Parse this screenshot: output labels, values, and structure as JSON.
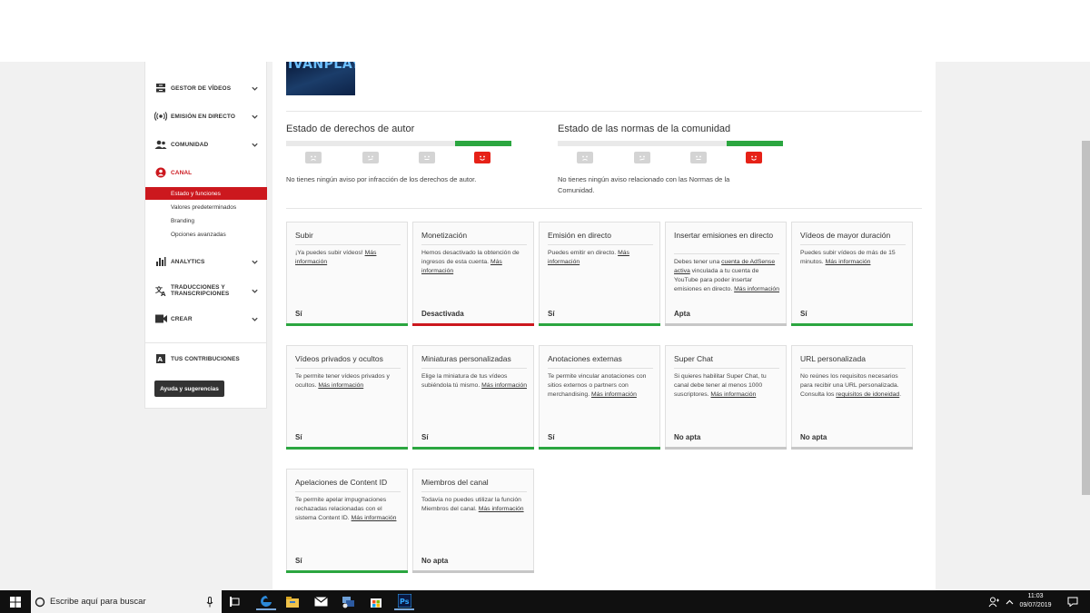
{
  "sidebar": {
    "items": [
      {
        "label": "GESTOR DE VÍDEOS",
        "icon": "video-manager-icon"
      },
      {
        "label": "EMISIÓN EN DIRECTO",
        "icon": "live-broadcast-icon"
      },
      {
        "label": "COMUNIDAD",
        "icon": "community-icon"
      },
      {
        "label": "CANAL",
        "icon": "channel-icon"
      },
      {
        "label": "ANALYTICS",
        "icon": "analytics-icon"
      },
      {
        "label": "TRADUCCIONES Y TRANSCRIPCIONES",
        "icon": "translate-icon"
      },
      {
        "label": "CREAR",
        "icon": "camera-icon"
      },
      {
        "label": "TUS CONTRIBUCIONES",
        "icon": "contributions-icon"
      }
    ],
    "channel_sub": [
      {
        "label": "Estado y funciones"
      },
      {
        "label": "Valores predeterminados"
      },
      {
        "label": "Branding"
      },
      {
        "label": "Opciones avanzadas"
      }
    ],
    "help_label": "Ayuda y sugerencias"
  },
  "avatar_text": "IVANPLAYS",
  "copyright": {
    "title": "Estado de derechos de autor",
    "message": "No tienes ningún aviso por infracción de los derechos de autor."
  },
  "community": {
    "title": "Estado de las normas de la comunidad",
    "message": "No tienes ningún aviso relacionado con las Normas de la Comunidad."
  },
  "more_info": "Más información",
  "cards": [
    {
      "title": "Subir",
      "desc": "¡Ya puedes subir vídeos!",
      "status": "Sí",
      "bar": "green"
    },
    {
      "title": "Monetización",
      "desc": "Hemos desactivado la obtención de ingresos de esta cuenta.",
      "status": "Desactivada",
      "bar": "red"
    },
    {
      "title": "Emisión en directo",
      "desc": "Puedes emitir en directo.",
      "status": "Sí",
      "bar": "green"
    },
    {
      "title": "Insertar emisiones en directo",
      "desc_pre": "Debes tener una",
      "desc_link": "cuenta de AdSense activa",
      "desc_post": "vinculada a tu cuenta de YouTube para poder insertar emisiones en directo.",
      "status": "Apta",
      "bar": "gray"
    },
    {
      "title": "Vídeos de mayor duración",
      "desc": "Puedes subir vídeos de más de 15 minutos.",
      "status": "Sí",
      "bar": "green"
    },
    {
      "title": "Vídeos privados y ocultos",
      "desc": "Te permite tener vídeos privados y ocultos.",
      "status": "Sí",
      "bar": "green"
    },
    {
      "title": "Miniaturas personalizadas",
      "desc": "Elige la miniatura de tus vídeos subiéndola tú mismo.",
      "status": "Sí",
      "bar": "green"
    },
    {
      "title": "Anotaciones externas",
      "desc": "Te permite vincular anotaciones con sitios externos o partners con merchandising.",
      "status": "Sí",
      "bar": "green"
    },
    {
      "title": "Super Chat",
      "desc": "Si quieres habilitar Super Chat, tu canal debe tener al menos 1000 suscriptores.",
      "status": "No apta",
      "bar": "gray"
    },
    {
      "title": "URL personalizada",
      "desc": "No reúnes los requisitos necesarios para recibir una URL personalizada. Consulta los",
      "desc_link": "requisitos de idoneidad",
      "status": "No apta",
      "bar": "gray"
    },
    {
      "title": "Apelaciones de Content ID",
      "desc": "Te permite apelar impugnaciones rechazadas relacionadas con el sistema Content ID.",
      "status": "Sí",
      "bar": "green"
    },
    {
      "title": "Miembros del canal",
      "desc": "Todavía no puedes utilizar la función Miembros del canal.",
      "status": "No apta",
      "bar": "gray"
    }
  ],
  "taskbar": {
    "search_placeholder": "Escribe aquí para buscar",
    "time": "11:03",
    "date": "09/07/2019"
  },
  "colors": {
    "accent_red": "#cc181e",
    "green": "#2ba640",
    "gray_bar": "#c7c7c7"
  }
}
